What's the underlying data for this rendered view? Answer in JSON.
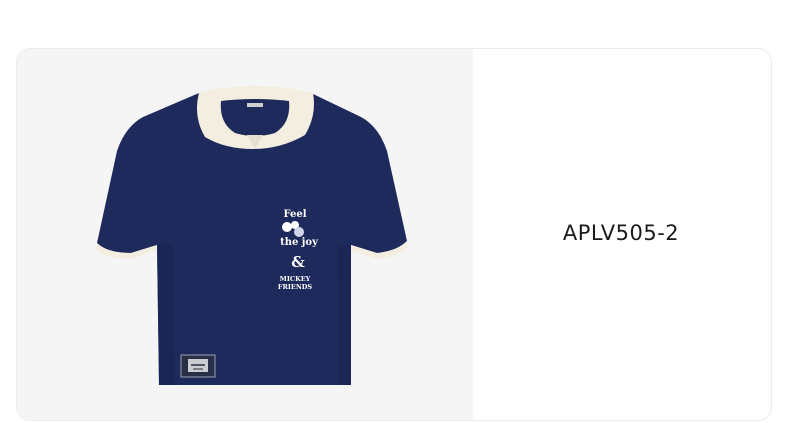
{
  "product": {
    "sku": "APLV505-2",
    "image": {
      "alt": "Navy polo shirt with cream collar and Mickey & Friends chest print",
      "print_lines": [
        "Feel",
        "the joy",
        "&",
        "MICKEY",
        "FRIENDS"
      ],
      "colors": {
        "body": "#1f2a5c",
        "collar": "#f3eee0"
      }
    }
  }
}
